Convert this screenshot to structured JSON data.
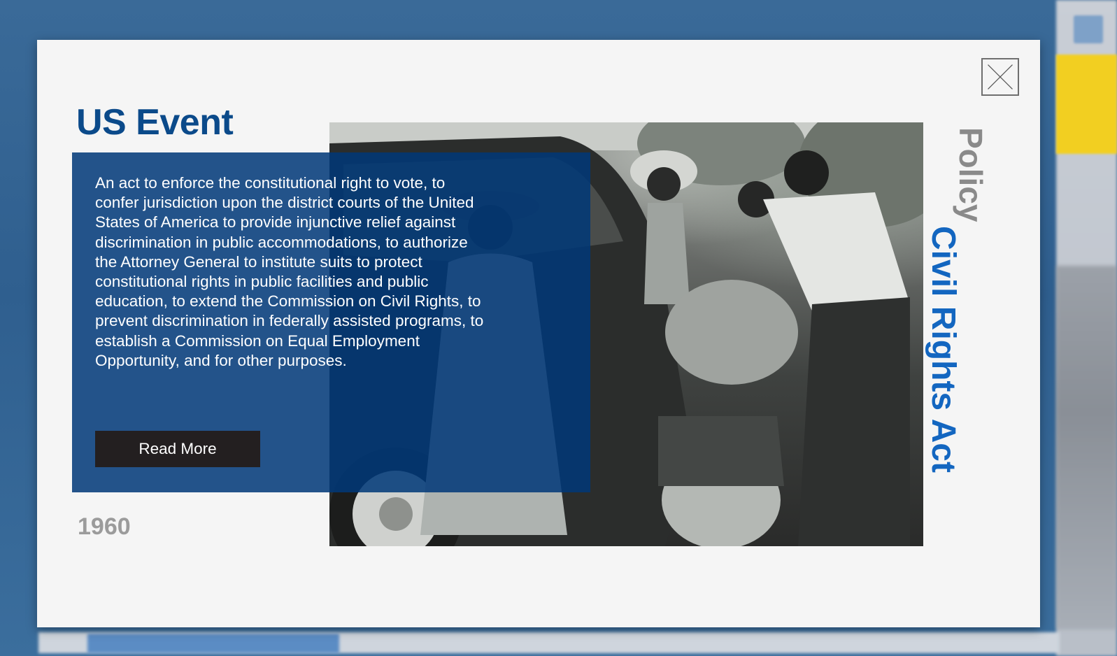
{
  "modal": {
    "kicker": "US Event",
    "category": "Policy",
    "title": "Civil Rights Act",
    "description": "An act to enforce the constitutional right to vote, to confer jurisdiction upon the district courts of the United States of America to provide injunctive relief against discrimination in public accommodations, to authorize the Attorney General to institute suits to protect constitutional rights in public facilities and public education, to extend the Commission on Civil Rights, to prevent discrimination in federally assisted programs, to establish a Commission on Equal Employment Opportunity, and for other purposes.",
    "read_more_label": "Read More",
    "year": "1960",
    "close_icon": "close-icon",
    "photo": "black-and-white photograph of people loading bundles onto a car"
  },
  "colors": {
    "kicker": "#0b4a8a",
    "card_overlay": "#003878",
    "title_accent": "#1366c0",
    "category_gray": "#8a8a8a",
    "year_gray": "#9b9b9b",
    "button_bg": "#231f20"
  }
}
